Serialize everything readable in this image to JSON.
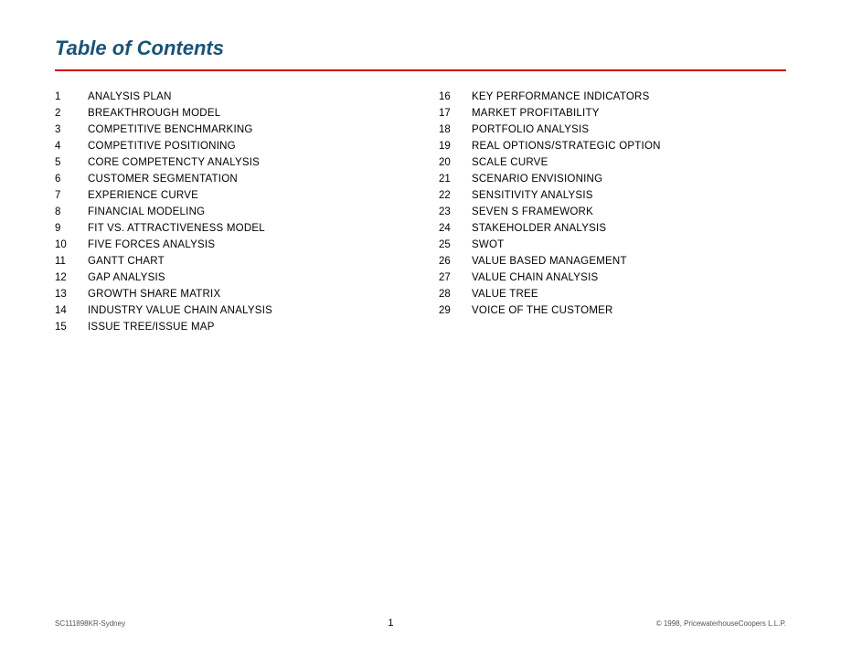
{
  "title": "Table of Contents",
  "divider_color": "#cc0000",
  "left_column": [
    {
      "num": "1",
      "label": "ANALYSIS PLAN"
    },
    {
      "num": "2",
      "label": "BREAKTHROUGH MODEL"
    },
    {
      "num": "3",
      "label": "COMPETITIVE BENCHMARKING"
    },
    {
      "num": "4",
      "label": "COMPETITIVE POSITIONING"
    },
    {
      "num": "5",
      "label": "CORE COMPETENCTY ANALYSIS"
    },
    {
      "num": "6",
      "label": "CUSTOMER SEGMENTATION"
    },
    {
      "num": "7",
      "label": "EXPERIENCE CURVE"
    },
    {
      "num": "8",
      "label": "FINANCIAL MODELING"
    },
    {
      "num": "9",
      "label": "FIT VS. ATTRACTIVENESS MODEL"
    },
    {
      "num": "10",
      "label": "FIVE FORCES ANALYSIS"
    },
    {
      "num": "11",
      "label": "GANTT CHART"
    },
    {
      "num": "12",
      "label": "GAP ANALYSIS"
    },
    {
      "num": "13",
      "label": "GROWTH SHARE MATRIX"
    },
    {
      "num": "14",
      "label": "INDUSTRY VALUE CHAIN ANALYSIS"
    },
    {
      "num": "15",
      "label": "ISSUE TREE/ISSUE MAP"
    }
  ],
  "right_column": [
    {
      "num": "16",
      "label": "KEY PERFORMANCE INDICATORS"
    },
    {
      "num": "17",
      "label": "MARKET PROFITABILITY"
    },
    {
      "num": "18",
      "label": "PORTFOLIO ANALYSIS"
    },
    {
      "num": "19",
      "label": "REAL OPTIONS/STRATEGIC OPTION"
    },
    {
      "num": "20",
      "label": "SCALE CURVE"
    },
    {
      "num": "21",
      "label": "SCENARIO ENVISIONING"
    },
    {
      "num": "22",
      "label": "SENSITIVITY ANALYSIS"
    },
    {
      "num": "23",
      "label": "SEVEN S FRAMEWORK"
    },
    {
      "num": "24",
      "label": "STAKEHOLDER ANALYSIS"
    },
    {
      "num": "25",
      "label": "SWOT"
    },
    {
      "num": "26",
      "label": "VALUE BASED MANAGEMENT"
    },
    {
      "num": "27",
      "label": "VALUE CHAIN ANALYSIS"
    },
    {
      "num": "28",
      "label": "VALUE TREE"
    },
    {
      "num": "29",
      "label": "VOICE OF THE CUSTOMER"
    }
  ],
  "footer": {
    "left": "SC111898KR-Sydney",
    "center": "1",
    "right": "© 1998, PricewaterhouseCoopers L.L.P."
  }
}
